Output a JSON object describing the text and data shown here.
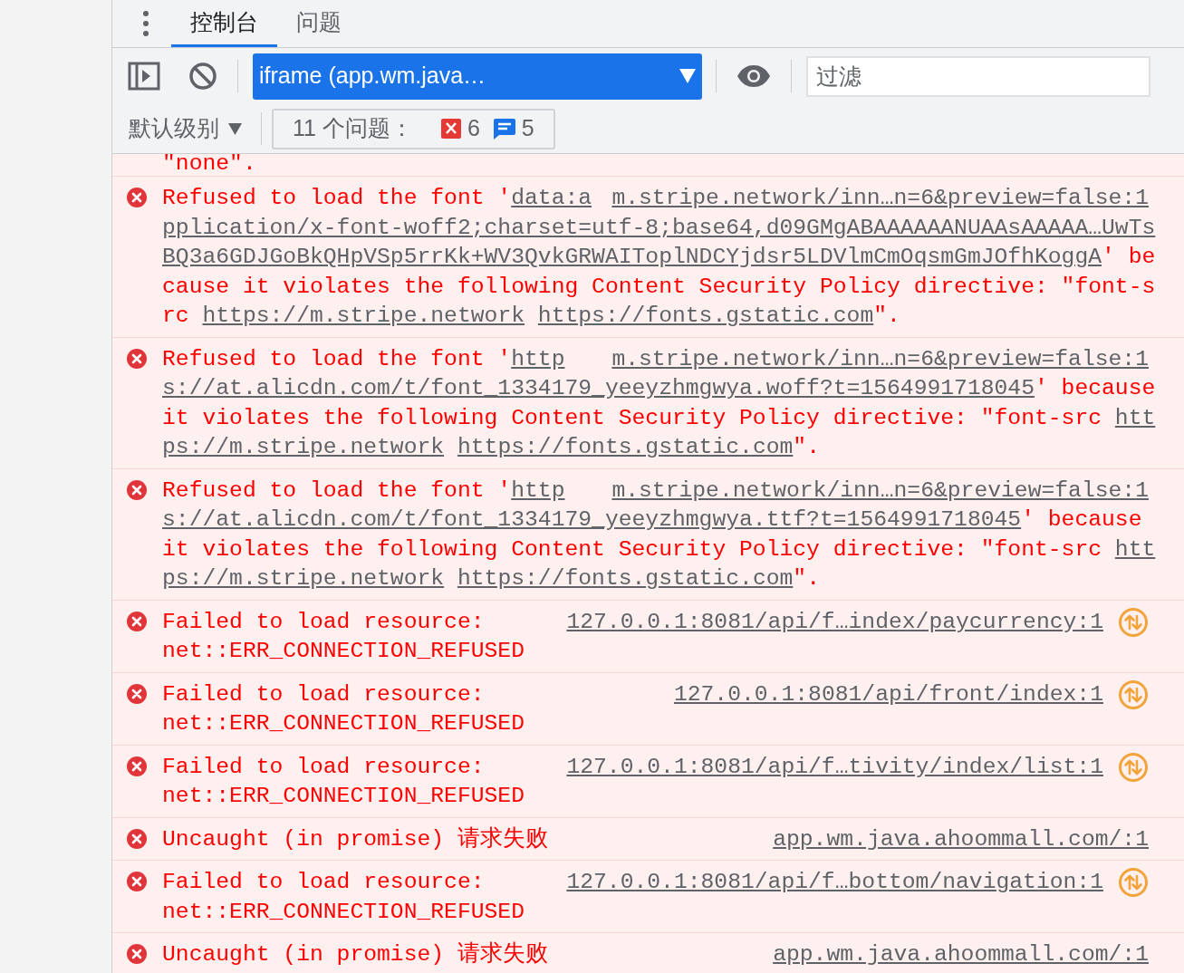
{
  "tabs": [
    {
      "label": "控制台",
      "selected": true
    },
    {
      "label": "问题",
      "selected": false
    }
  ],
  "toolbar": {
    "context": "iframe (app.wm.java…",
    "filter_placeholder": "过滤",
    "level": "默认级别",
    "issues": {
      "label": "11 个问题：",
      "errors": "6",
      "info": "5"
    }
  },
  "messages": [
    {
      "kind": "fragment",
      "segments": [
        {
          "text": "\"none\".",
          "link": false
        }
      ]
    },
    {
      "kind": "csp",
      "source": "m.stripe.network/inn…n=6&preview=false:1",
      "first_line": [
        {
          "text": "Refused to load the font '",
          "link": false
        },
        {
          "text": "data:a",
          "link": true
        }
      ],
      "segments": [
        {
          "text": "pplication/x-font-woff2;charset=utf-8;base64,d09GMgABAAAAAANUAAsAAAAA…UwTsBQ3a6GDJGoBkQHpVSp5rrKk+WV3QvkGRWAIToplNDCYjdsr5LDVlmCmOqsmGmJOfhKoggA",
          "link": true
        },
        {
          "text": "' because it violates the following Content Security Policy directive: \"font-src ",
          "link": false
        },
        {
          "text": "https://m.stripe.network",
          "link": true,
          "space_after": true
        },
        {
          "text": "https://fonts.gstatic.com",
          "link": true
        },
        {
          "text": "\".",
          "link": false
        }
      ]
    },
    {
      "kind": "csp",
      "source": "m.stripe.network/inn…n=6&preview=false:1",
      "first_line": [
        {
          "text": "Refused to load the font '",
          "link": false
        },
        {
          "text": "http",
          "link": true
        }
      ],
      "segments": [
        {
          "text": "s://at.alicdn.com/t/font_1334179_yeeyzhmgwya.woff?t=1564991718045",
          "link": true
        },
        {
          "text": "' because it violates the following Content Security Policy directive: \"font-src ",
          "link": false
        },
        {
          "text": "https://m.stripe.network",
          "link": true,
          "space_after": true
        },
        {
          "text": "https://fonts.gstatic.com",
          "link": true
        },
        {
          "text": "\".",
          "link": false
        }
      ]
    },
    {
      "kind": "csp",
      "source": "m.stripe.network/inn…n=6&preview=false:1",
      "first_line": [
        {
          "text": "Refused to load the font '",
          "link": false
        },
        {
          "text": "http",
          "link": true
        }
      ],
      "segments": [
        {
          "text": "s://at.alicdn.com/t/font_1334179_yeeyzhmgwya.ttf?t=1564991718045",
          "link": true
        },
        {
          "text": "' because it violates the following Content Security Policy directive: \"font-src ",
          "link": false
        },
        {
          "text": "https://m.stripe.network",
          "link": true,
          "space_after": true
        },
        {
          "text": "https://fonts.gstatic.com",
          "link": true
        },
        {
          "text": "\".",
          "link": false
        }
      ]
    },
    {
      "kind": "network",
      "source": "127.0.0.1:8081/api/f…index/paycurrency:1",
      "segments": [
        {
          "text": "Failed to load resource: net::ERR_CONNECTION_REFUSED",
          "link": false
        }
      ]
    },
    {
      "kind": "network",
      "source": "127.0.0.1:8081/api/front/index:1",
      "segments": [
        {
          "text": "Failed to load resource: net::ERR_CONNECTION_REFUSED",
          "link": false
        }
      ]
    },
    {
      "kind": "network",
      "source": "127.0.0.1:8081/api/f…tivity/index/list:1",
      "segments": [
        {
          "text": "Failed to load resource: net::ERR_CONNECTION_REFUSED",
          "link": false
        }
      ]
    },
    {
      "kind": "uncaught",
      "source": "app.wm.java.ahoommall.com/:1",
      "segments": [
        {
          "text": "Uncaught (in promise) 请求失败",
          "link": false
        }
      ]
    },
    {
      "kind": "network",
      "source": "127.0.0.1:8081/api/f…bottom/navigation:1",
      "segments": [
        {
          "text": "Failed to load resource: net::ERR_CONNECTION_REFUSED",
          "link": false
        }
      ]
    },
    {
      "kind": "uncaught",
      "source": "app.wm.java.ahoommall.com/:1",
      "segments": [
        {
          "text": "Uncaught (in promise) 请求失败",
          "link": false
        }
      ]
    }
  ]
}
